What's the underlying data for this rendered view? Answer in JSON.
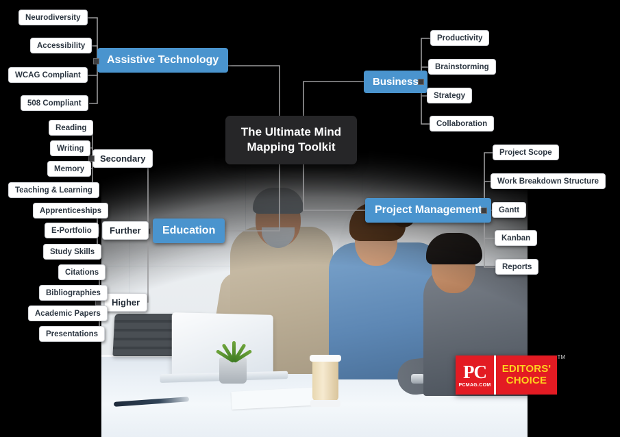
{
  "center": {
    "title_line1": "The Ultimate Mind",
    "title_line2": "Mapping Toolkit"
  },
  "colors": {
    "accent_blue": "#4a94ce",
    "center_dark": "#262628",
    "leaf_white": "#ffffff",
    "background": "#000000",
    "badge_red": "#e31b23",
    "badge_yellow": "#ffd21e"
  },
  "branches": [
    {
      "id": "assistive-technology",
      "label": "Assistive Technology",
      "leaves": [
        "Neurodiversity",
        "Accessibility",
        "WCAG Compliant",
        "508 Compliant"
      ]
    },
    {
      "id": "business",
      "label": "Business",
      "leaves": [
        "Productivity",
        "Brainstorming",
        "Strategy",
        "Collaboration"
      ]
    },
    {
      "id": "project-management",
      "label": "Project Management",
      "leaves": [
        "Project Scope",
        "Work Breakdown Structure",
        "Gantt",
        "Kanban",
        "Reports"
      ]
    },
    {
      "id": "education",
      "label": "Education",
      "subbranches": [
        {
          "id": "secondary",
          "label": "Secondary",
          "leaves": [
            "Reading",
            "Writing",
            "Memory",
            "Teaching & Learning"
          ]
        },
        {
          "id": "further",
          "label": "Further",
          "leaves": [
            "Apprenticeships",
            "E-Portfolio",
            "Study Skills"
          ]
        },
        {
          "id": "higher",
          "label": "Higher",
          "leaves": [
            "Citations",
            "Bibliographies",
            "Academic Papers",
            "Presentations"
          ]
        }
      ]
    }
  ],
  "badge": {
    "brand": "PC",
    "domain": "PCMAG.COM",
    "award_line1": "EDITORS'",
    "award_line2": "CHOICE",
    "tm": "TM"
  },
  "photo": {
    "alt": "three colleagues at an office desk with a laptop"
  }
}
